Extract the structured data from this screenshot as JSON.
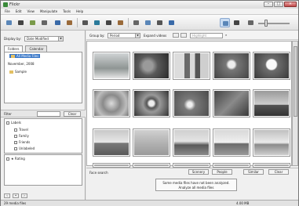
{
  "window": {
    "title": "Flickr"
  },
  "menu": [
    "File",
    "Edit",
    "View",
    "Manipulate",
    "Tools",
    "Help"
  ],
  "left": {
    "display_by_label": "Display by:",
    "display_by_value": "Date Modified",
    "tabs": [
      "Folders",
      "Calendar"
    ],
    "folders": [
      "All Media Files",
      "November, 2008",
      "Sample"
    ],
    "filter_label": "Filter",
    "filter_clear": "Clear",
    "labels_root": "Labels",
    "labels": [
      "Travel",
      "Family",
      "Friends",
      "Unlabeled"
    ],
    "rating_root": "Rating"
  },
  "right": {
    "group_by_label": "Group by:",
    "group_by_value": "Period",
    "expand_label": "Expand videos",
    "search_placeholder": "Highlight",
    "face_search_label": "Face search",
    "buttons": [
      "Scenery",
      "People",
      "Similar",
      "Clear"
    ],
    "analysis_note_line1": "Some media files have not been analyzed.",
    "analysis_note_line2": "Analyze all media files"
  },
  "status": {
    "left": "29 media files",
    "right": "4.00 MB"
  },
  "colors": {
    "accent": "#3a78c8",
    "selection": "#3a78c8"
  }
}
